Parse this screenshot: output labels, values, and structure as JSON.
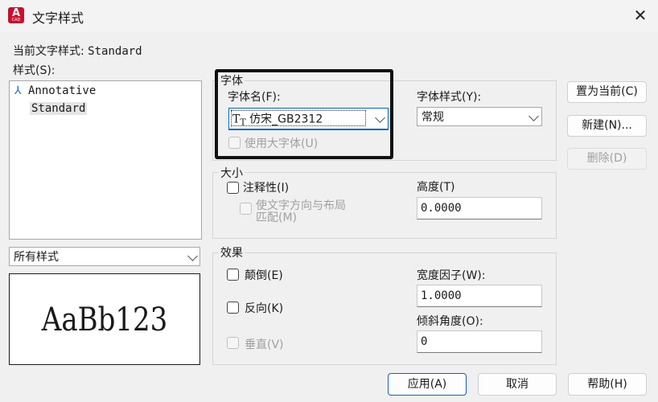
{
  "window": {
    "title": "文字样式",
    "app_icon_letter": "A",
    "app_icon_caption": "CAD"
  },
  "current_style": {
    "label": "当前文字样式:",
    "value": "Standard"
  },
  "styles": {
    "label": "样式(S):",
    "items": [
      "Annotative",
      "Standard"
    ],
    "selected": "Standard"
  },
  "filter": {
    "value": "所有样式"
  },
  "preview": {
    "text": "AaBb123"
  },
  "font": {
    "group_title": "字体",
    "name_label": "字体名(F):",
    "name_value": "仿宋_GB2312",
    "style_label": "字体样式(Y):",
    "style_value": "常规",
    "bigfont_label": "使用大字体(U)"
  },
  "size": {
    "group_title": "大小",
    "annotative_label": "注释性(I)",
    "match_line1": "使文字方向与布局",
    "match_line2": "匹配(M)",
    "height_label": "高度(T)",
    "height_value": "0.0000"
  },
  "effects": {
    "group_title": "效果",
    "upside_down": "颠倒(E)",
    "backwards": "反向(K)",
    "vertical": "垂直(V)",
    "width_label": "宽度因子(W):",
    "width_value": "1.0000",
    "oblique_label": "倾斜角度(O):",
    "oblique_value": "0"
  },
  "buttons": {
    "set_current": "置为当前(C)",
    "new": "新建(N)...",
    "delete": "删除(D)",
    "apply": "应用(A)",
    "cancel": "取消",
    "help": "帮助(H)"
  },
  "colors": {
    "accent": "#0067c0",
    "app_icon": "#c8102e"
  }
}
